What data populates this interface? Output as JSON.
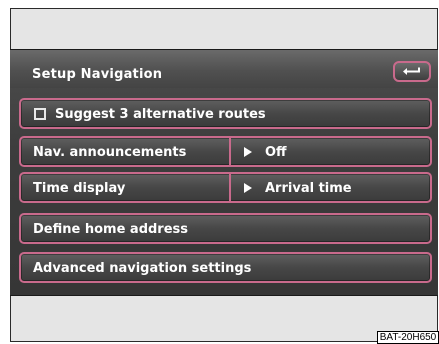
{
  "header": {
    "title": "Setup Navigation",
    "back_icon": "return-arrow-icon"
  },
  "menu": {
    "suggest_routes": {
      "label": "Suggest 3 alternative routes",
      "checked": false
    },
    "nav_announcements": {
      "label": "Nav. announcements",
      "value": "Off"
    },
    "time_display": {
      "label": "Time display",
      "value": "Arrival time"
    },
    "home_address": {
      "label": "Define home address"
    },
    "advanced": {
      "label": "Advanced navigation settings"
    }
  },
  "figure_tag": "BAT-20H650",
  "colors": {
    "accent": "#c96a8c",
    "panel": "#444444",
    "text": "#ffffff"
  }
}
